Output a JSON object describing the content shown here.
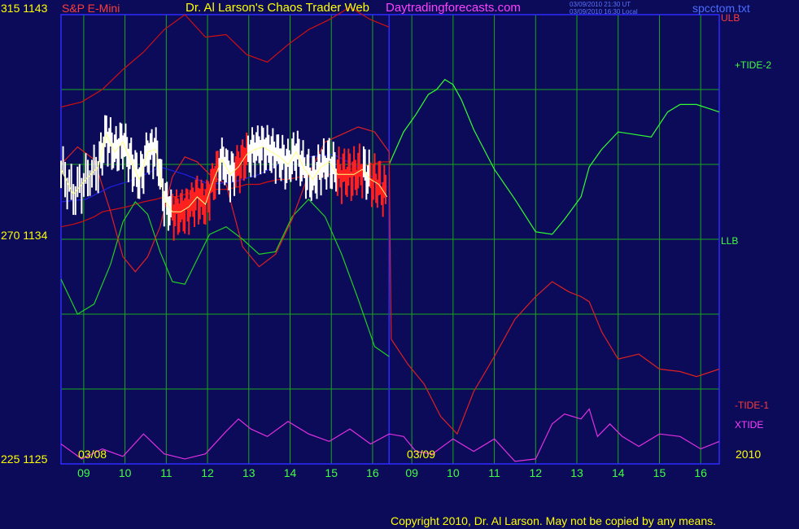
{
  "header": {
    "left_price_label": "315 1143",
    "symbol": "S&P E-Mini",
    "title": "Dr. Al Larson's Chaos Trader Web",
    "site": "Daytradingforecasts.com",
    "timestamp_ut": "03/09/2010 21:30 UT",
    "timestamp_local": "03/09/2010 16:30 Local",
    "file": "spcctom.txt"
  },
  "y_labels": {
    "top": "315 1143",
    "mid": "270 1134",
    "bottom": "225 1125"
  },
  "date_labels": {
    "first": "03/08",
    "second": "03/09",
    "year": "2010"
  },
  "x_hour_labels": [
    "09",
    "10",
    "11",
    "12",
    "13",
    "14",
    "15",
    "16",
    "09",
    "10",
    "11",
    "12",
    "13",
    "14",
    "15",
    "16"
  ],
  "copyright": "Copyright 2010, Dr. Al Larson. May not be copied by any means.",
  "colors": {
    "background": "#0b0b5a",
    "grid": "#18a818",
    "axis": "#2c2cff",
    "ulb": "#d01010",
    "llb": "#20d020",
    "tide2": "#30ff30",
    "tide1": "#e02020",
    "xtide": "#e030e0",
    "price_up": "#ffffff",
    "price_down": "#ff2020",
    "avg": "#ffff80",
    "blue_avg": "#2020e0"
  },
  "chart_data": {
    "type": "line",
    "x_unit": "trading hour index (0 = 03/08 08:30)",
    "y_range_price": [
      1125,
      1143
    ],
    "x_range": [
      0,
      15.95
    ],
    "grid": true,
    "series_labels": [
      "ULB",
      "+TIDE-2",
      "LLB",
      "-TIDE-1",
      "XTIDE"
    ],
    "series": [
      {
        "name": "ULB",
        "color": "#d01010",
        "x": [
          0,
          0.5,
          1,
          1.5,
          2,
          2.5,
          3,
          3.5,
          4,
          4.5,
          5,
          5.5,
          6,
          6.5,
          7,
          7.5,
          7.95
        ],
        "y": [
          1139.3,
          1139.5,
          1140,
          1140.8,
          1141.5,
          1142.4,
          1143,
          1142.1,
          1142.2,
          1141.4,
          1141.1,
          1141.8,
          1142.4,
          1142.8,
          1143.3,
          1142.8,
          1142.5
        ]
      },
      {
        "name": "ULB",
        "color": "#d01010",
        "x": [
          0,
          0.3,
          0.5,
          0.8,
          1,
          1.3,
          1.6,
          1.8,
          2,
          2.3,
          2.5,
          2.8,
          3,
          3.3,
          3.5,
          3.8,
          4,
          4.3,
          4.5,
          4.8,
          5,
          5.3,
          5.5,
          5.8,
          6,
          6.3,
          6.5,
          6.8,
          7,
          7.3,
          7.5,
          7.8,
          7.95
        ],
        "y": [
          1134.5,
          1134.6,
          1134.7,
          1134.9,
          1135.1,
          1135.2,
          1135.3,
          1135.4,
          1135.5,
          1135.6,
          1135.7,
          1135.7,
          1135.8,
          1135.9,
          1136,
          1136.0,
          1136,
          1136.1,
          1136.2,
          1136.2,
          1136.3,
          1136.4,
          1136.4,
          1136.5,
          1136.5,
          1136.5,
          1136.6,
          1136.7,
          1136.8,
          1136.9,
          1137,
          1137.1,
          1137.1
        ]
      },
      {
        "name": "LLB",
        "color": "#20d020",
        "x": [
          0,
          0.4,
          0.8,
          1.2,
          1.5,
          1.8,
          2.1,
          2.4,
          2.7,
          3,
          3.3,
          3.6,
          4,
          4.4,
          4.8,
          5.2,
          5.6,
          6,
          6.4,
          6.8,
          7.2,
          7.6,
          7.95
        ],
        "y": [
          1132.4,
          1131,
          1131.4,
          1133,
          1134.7,
          1135.5,
          1135,
          1133.5,
          1132.3,
          1132.2,
          1133.2,
          1134.2,
          1134.5,
          1134,
          1133.4,
          1133.5,
          1134.9,
          1135.6,
          1134.9,
          1133.4,
          1131.6,
          1129.7,
          1129.3
        ]
      },
      {
        "name": "+TIDE-2",
        "color": "#30ff30",
        "x": [
          7.95,
          8.3,
          8.6,
          8.9,
          9.1,
          9.3,
          9.5,
          9.7,
          10,
          10.5,
          11,
          11.5,
          11.9,
          12.2,
          12.6,
          12.8,
          13.1,
          13.5,
          13.9,
          14.3,
          14.7,
          15,
          15.4,
          15.95
        ],
        "y": [
          1137,
          1138.3,
          1139,
          1139.8,
          1140,
          1140.4,
          1140.2,
          1139.6,
          1138.4,
          1136.8,
          1135.6,
          1134.3,
          1134.2,
          1134.8,
          1135.7,
          1136.9,
          1137.6,
          1138.3,
          1138.2,
          1138.1,
          1139.1,
          1139.4,
          1139.4,
          1139.1
        ]
      },
      {
        "name": "-TIDE-1",
        "color": "#e02020",
        "x": [
          0,
          0.4,
          0.8,
          1.2,
          1.5,
          1.8,
          2.1,
          2.4,
          2.7,
          3,
          3.3,
          3.6,
          4,
          4.4,
          4.8,
          5.2,
          5.6,
          6,
          6.4,
          6.8,
          7.2,
          7.6,
          7.95,
          8.0,
          8.4,
          8.8,
          9.2,
          9.6,
          10,
          10.5,
          11,
          11.5,
          11.9,
          12.3,
          12.6,
          12.8,
          13.1,
          13.5,
          14,
          14.5,
          15,
          15.4,
          15.95
        ],
        "y": [
          1137,
          1137.7,
          1137.2,
          1135.1,
          1133.3,
          1132.7,
          1133.3,
          1134.5,
          1136.5,
          1137.3,
          1137.1,
          1136.6,
          1136.2,
          1133.7,
          1132.9,
          1133.4,
          1134.8,
          1136.6,
          1137.9,
          1138.2,
          1138.5,
          1138.3,
          1137.5,
          1130,
          1129,
          1128.2,
          1126.9,
          1126.2,
          1127.9,
          1129.3,
          1130.8,
          1131.7,
          1132.3,
          1131.9,
          1131.7,
          1131.5,
          1130.3,
          1129.2,
          1129.4,
          1128.8,
          1128.7,
          1128.5,
          1128.8
        ]
      },
      {
        "name": "XTIDE",
        "color": "#e030e0",
        "x": [
          0,
          0.5,
          1,
          1.5,
          2,
          2.5,
          3,
          3.5,
          4,
          4.3,
          4.6,
          5,
          5.5,
          6,
          6.5,
          7,
          7.5,
          7.95,
          8.3,
          8.6,
          9,
          9.5,
          10,
          10.5,
          11,
          11.5,
          11.9,
          12.2,
          12.6,
          12.8,
          13,
          13.3,
          13.6,
          14,
          14.5,
          15,
          15.5,
          15.95
        ],
        "y": [
          1125.8,
          1125.2,
          1125.6,
          1125.3,
          1126.2,
          1125.4,
          1125.2,
          1125.4,
          1126.3,
          1126.8,
          1126.4,
          1126.1,
          1126.7,
          1126.2,
          1125.9,
          1126.4,
          1125.8,
          1126.2,
          1126.1,
          1125.5,
          1125.4,
          1126,
          1125.5,
          1126,
          1125.1,
          1125.2,
          1126.6,
          1127,
          1126.8,
          1127.2,
          1126.1,
          1126.6,
          1126.1,
          1125.7,
          1126.2,
          1126.1,
          1125.6,
          1125.9
        ]
      }
    ],
    "price": {
      "name": "S&P E-Mini",
      "x": [
        0,
        0.3,
        0.6,
        0.9,
        1.1,
        1.3,
        1.5,
        1.7,
        1.9,
        2.1,
        2.3,
        2.5,
        2.7,
        2.9,
        3.1,
        3.3,
        3.5,
        3.7,
        3.9,
        4.1,
        4.3,
        4.5,
        4.7,
        4.9,
        5.1,
        5.3,
        5.5,
        5.7,
        5.9,
        6.1,
        6.3,
        6.5,
        6.7,
        6.9,
        7.1,
        7.3,
        7.5,
        7.7,
        7.9
      ],
      "y": [
        1136.8,
        1135.8,
        1136.4,
        1136.9,
        1138.2,
        1137.5,
        1137.9,
        1137.1,
        1136.4,
        1137.5,
        1137.6,
        1135.6,
        1135.1,
        1135.1,
        1135.3,
        1135.7,
        1135.4,
        1136.4,
        1137.2,
        1136.6,
        1136.9,
        1137.4,
        1137.6,
        1137.7,
        1137.5,
        1137.3,
        1137,
        1137.5,
        1136.8,
        1136.4,
        1136.9,
        1137.1,
        1136.6,
        1136.6,
        1136.6,
        1136.8,
        1136.4,
        1136.2,
        1135.7
      ],
      "down_ranges": [
        [
          2.7,
          3.8
        ],
        [
          4.2,
          4.5
        ],
        [
          6.7,
          7.3
        ],
        [
          7.5,
          7.9
        ]
      ]
    },
    "blue_average": {
      "x": [
        0,
        0.6,
        1.2,
        1.8,
        2.4,
        3,
        3.6,
        4.2,
        4.8,
        5.4,
        6,
        6.6,
        7.2,
        7.9
      ],
      "y": [
        1135.5,
        1135.6,
        1136.1,
        1136.4,
        1136.9,
        1136.6,
        1136.2,
        1136.3,
        1136.6,
        1137.1,
        1137.3,
        1137.4,
        1136.9,
        1136.1
      ]
    }
  }
}
